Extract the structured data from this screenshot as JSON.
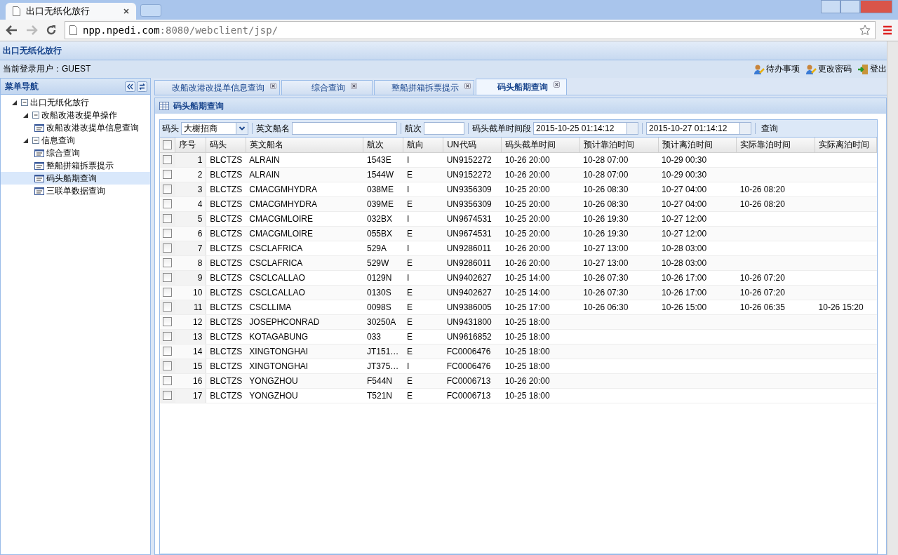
{
  "browser": {
    "tab_title": "出口无纸化放行",
    "url_host": "npp.npedi.com",
    "url_path": ":8080/webclient/jsp/"
  },
  "app": {
    "title": "出口无纸化放行",
    "user_label": "当前登录用户：GUEST",
    "actions": [
      {
        "label": "待办事项",
        "kind": "person"
      },
      {
        "label": "更改密码",
        "kind": "person"
      },
      {
        "label": "登出",
        "kind": "exit"
      }
    ]
  },
  "sidebar": {
    "title": "菜单导航",
    "tree": [
      {
        "label": "出口无纸化放行",
        "expanded": true,
        "children": [
          {
            "label": "改船改港改提单操作",
            "expanded": true,
            "children": [
              {
                "label": "改船改港改提单信息查询",
                "selected": false
              }
            ]
          },
          {
            "label": "信息查询",
            "expanded": true,
            "children": [
              {
                "label": "综合查询",
                "selected": false
              },
              {
                "label": "整船拼箱拆票提示",
                "selected": false
              },
              {
                "label": "码头船期查询",
                "selected": true
              },
              {
                "label": "三联单数据查询",
                "selected": false
              }
            ]
          }
        ]
      }
    ]
  },
  "tabs": [
    {
      "label": "改船改港改提单信息查询",
      "selected": false
    },
    {
      "label": "综合查询",
      "selected": false
    },
    {
      "label": "整船拼箱拆票提示",
      "selected": false
    },
    {
      "label": "码头船期查询",
      "selected": true
    }
  ],
  "panel": {
    "title": "码头船期查询"
  },
  "filters": {
    "terminal_label": "码头",
    "terminal_value": "大榭招商",
    "ship_label": "英文船名",
    "voyage_label": "航次",
    "period_label": "码头截单时间段",
    "from": "2015-10-25 01:14:12",
    "to": "2015-10-27 01:14:12",
    "query": "查询"
  },
  "table": {
    "select_all": false,
    "columns": [
      "序号",
      "码头",
      "英文船名",
      "航次",
      "航向",
      "UN代码",
      "码头截单时间",
      "预计靠泊时间",
      "预计离泊时间",
      "实际靠泊时间",
      "实际离泊时间"
    ],
    "rows": [
      {
        "checked": false,
        "no": "1",
        "terminal": "BLCTZS",
        "ship": "ALRAIN",
        "voyage": "1543E",
        "direction": "I",
        "un": "UN9152272",
        "cutoff": "10-26 20:00",
        "eta": "10-28 07:00",
        "etd": "10-29 00:30"
      },
      {
        "checked": false,
        "no": "2",
        "terminal": "BLCTZS",
        "ship": "ALRAIN",
        "voyage": "1544W",
        "direction": "E",
        "un": "UN9152272",
        "cutoff": "10-26 20:00",
        "eta": "10-28 07:00",
        "etd": "10-29 00:30"
      },
      {
        "checked": false,
        "no": "3",
        "terminal": "BLCTZS",
        "ship": "CMACGMHYDRA",
        "voyage": "038ME",
        "direction": "I",
        "un": "UN9356309",
        "cutoff": "10-25 20:00",
        "eta": "10-26 08:30",
        "etd": "10-27 04:00",
        "ata": "10-26 08:20"
      },
      {
        "checked": false,
        "no": "4",
        "terminal": "BLCTZS",
        "ship": "CMACGMHYDRA",
        "voyage": "039ME",
        "direction": "E",
        "un": "UN9356309",
        "cutoff": "10-25 20:00",
        "eta": "10-26 08:30",
        "etd": "10-27 04:00",
        "ata": "10-26 08:20"
      },
      {
        "checked": false,
        "no": "5",
        "terminal": "BLCTZS",
        "ship": "CMACGMLOIRE",
        "voyage": "032BX",
        "direction": "I",
        "un": "UN9674531",
        "cutoff": "10-25 20:00",
        "eta": "10-26 19:30",
        "etd": "10-27 12:00"
      },
      {
        "checked": false,
        "no": "6",
        "terminal": "BLCTZS",
        "ship": "CMACGMLOIRE",
        "voyage": "055BX",
        "direction": "E",
        "un": "UN9674531",
        "cutoff": "10-25 20:00",
        "eta": "10-26 19:30",
        "etd": "10-27 12:00"
      },
      {
        "checked": false,
        "no": "7",
        "terminal": "BLCTZS",
        "ship": "CSCLAFRICA",
        "voyage": "529A",
        "direction": "I",
        "un": "UN9286011",
        "cutoff": "10-26 20:00",
        "eta": "10-27 13:00",
        "etd": "10-28 03:00"
      },
      {
        "checked": false,
        "no": "8",
        "terminal": "BLCTZS",
        "ship": "CSCLAFRICA",
        "voyage": "529W",
        "direction": "E",
        "un": "UN9286011",
        "cutoff": "10-26 20:00",
        "eta": "10-27 13:00",
        "etd": "10-28 03:00"
      },
      {
        "checked": false,
        "no": "9",
        "terminal": "BLCTZS",
        "ship": "CSCLCALLAO",
        "voyage": "0129N",
        "direction": "I",
        "un": "UN9402627",
        "cutoff": "10-25 14:00",
        "eta": "10-26 07:30",
        "etd": "10-26 17:00",
        "ata": "10-26 07:20"
      },
      {
        "checked": false,
        "no": "10",
        "terminal": "BLCTZS",
        "ship": "CSCLCALLAO",
        "voyage": "0130S",
        "direction": "E",
        "un": "UN9402627",
        "cutoff": "10-25 14:00",
        "eta": "10-26 07:30",
        "etd": "10-26 17:00",
        "ata": "10-26 07:20"
      },
      {
        "checked": false,
        "no": "11",
        "terminal": "BLCTZS",
        "ship": "CSCLLIMA",
        "voyage": "0098S",
        "direction": "E",
        "un": "UN9386005",
        "cutoff": "10-25 17:00",
        "eta": "10-26 06:30",
        "etd": "10-26 15:00",
        "ata": "10-26 06:35",
        "atd": "10-26 15:20"
      },
      {
        "checked": false,
        "no": "12",
        "terminal": "BLCTZS",
        "ship": "JOSEPHCONRAD",
        "voyage": "30250A",
        "direction": "E",
        "un": "UN9431800",
        "cutoff": "10-25 18:00"
      },
      {
        "checked": false,
        "no": "13",
        "terminal": "BLCTZS",
        "ship": "KOTAGABUNG",
        "voyage": "033",
        "direction": "E",
        "un": "UN9616852",
        "cutoff": "10-25 18:00"
      },
      {
        "checked": false,
        "no": "14",
        "terminal": "BLCTZS",
        "ship": "XINGTONGHAI",
        "voyage": "JT151…",
        "direction": "E",
        "un": "FC0006476",
        "cutoff": "10-25 18:00"
      },
      {
        "checked": false,
        "no": "15",
        "terminal": "BLCTZS",
        "ship": "XINGTONGHAI",
        "voyage": "JT375…",
        "direction": "I",
        "un": "FC0006476",
        "cutoff": "10-25 18:00"
      },
      {
        "checked": false,
        "no": "16",
        "terminal": "BLCTZS",
        "ship": "YONGZHOU",
        "voyage": "F544N",
        "direction": "E",
        "un": "FC0006713",
        "cutoff": "10-26 20:00"
      },
      {
        "checked": false,
        "no": "17",
        "terminal": "BLCTZS",
        "ship": "YONGZHOU",
        "voyage": "T521N",
        "direction": "E",
        "un": "FC0006713",
        "cutoff": "10-25 18:00"
      }
    ]
  }
}
